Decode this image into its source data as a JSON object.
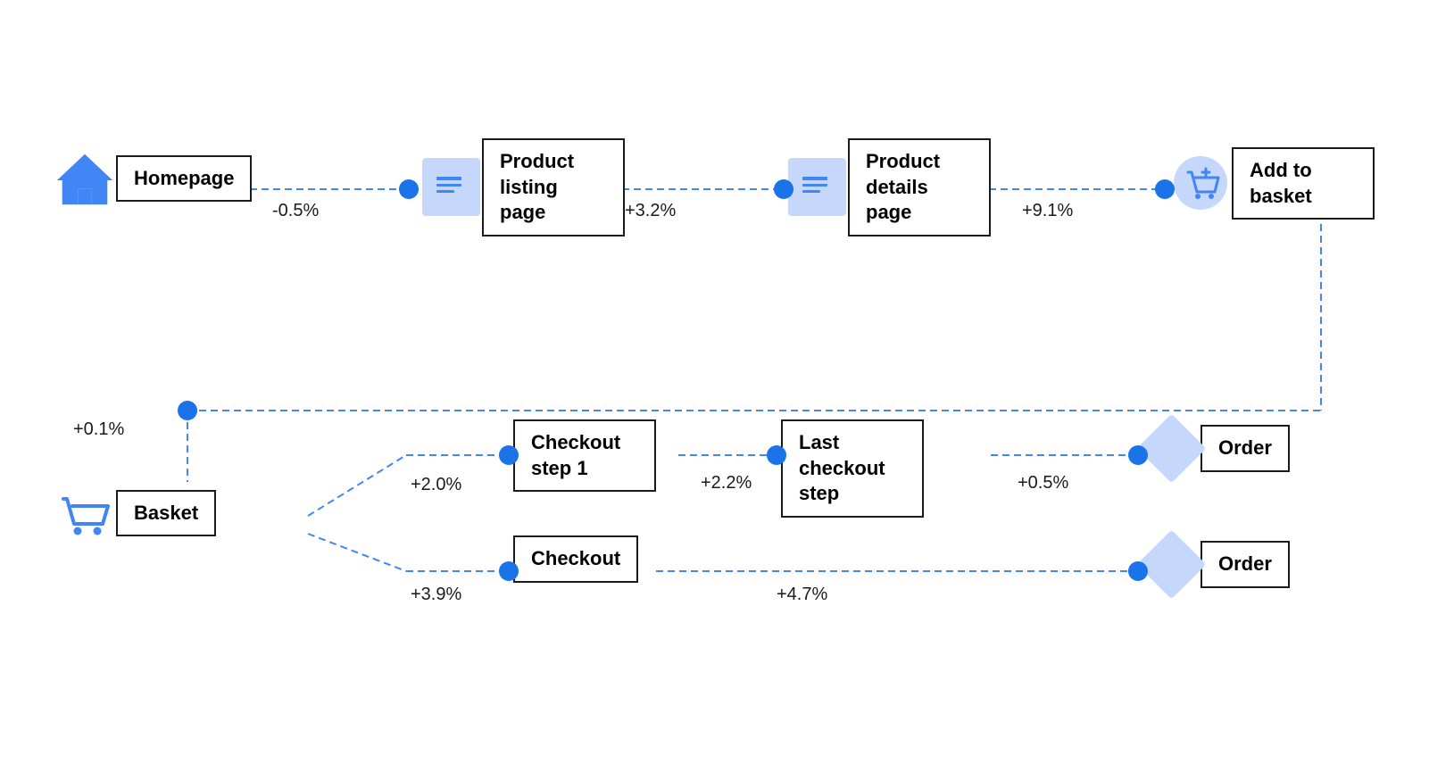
{
  "nodes": {
    "homepage": {
      "label": "Homepage"
    },
    "product_listing": {
      "label": "Product listing page"
    },
    "product_details": {
      "label": "Product details page"
    },
    "add_to_basket": {
      "label": "Add to basket"
    },
    "basket": {
      "label": "Basket"
    },
    "checkout_step1": {
      "label": "Checkout step 1"
    },
    "last_checkout": {
      "label": "Last checkout step"
    },
    "order1": {
      "label": "Order"
    },
    "checkout": {
      "label": "Checkout"
    },
    "order2": {
      "label": "Order"
    }
  },
  "edges": {
    "home_to_listing": "-0.5%",
    "listing_to_details": "+3.2%",
    "details_to_basket": "+9.1%",
    "basket_loop": "+0.1%",
    "basket_to_checkout1": "+2.0%",
    "checkout1_to_last": "+2.2%",
    "last_to_order1": "+0.5%",
    "basket_to_checkout": "+3.9%",
    "checkout_to_order2": "+4.7%"
  },
  "colors": {
    "blue": "#4285f4",
    "light_blue": "#c5d8fb",
    "dot": "#1a73e8",
    "border": "#1a1a1a",
    "dashed": "#4285f4"
  }
}
